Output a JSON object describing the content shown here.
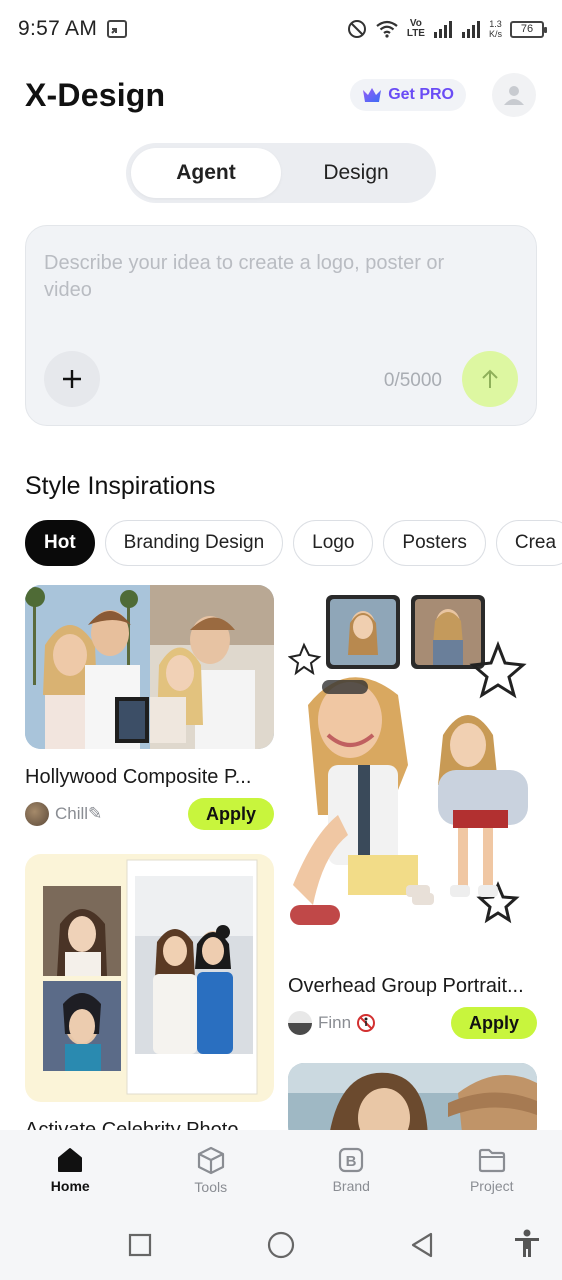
{
  "status_bar": {
    "time": "9:57 AM",
    "network_top": "Vo",
    "network_bottom": "LTE",
    "speed_top": "1.3",
    "speed_bottom": "K/s",
    "battery": "76"
  },
  "header": {
    "title": "X-Design",
    "get_pro_label": "Get PRO",
    "pro_color": "#6a4cf5"
  },
  "mode_switch": {
    "agent_label": "Agent",
    "design_label": "Design",
    "selected": "Agent"
  },
  "prompt": {
    "placeholder": "Describe your idea to create a logo, poster or video",
    "counter": "0/5000",
    "send_color": "#ddf7a1"
  },
  "inspirations": {
    "title": "Style Inspirations",
    "chips": [
      "Hot",
      "Branding Design",
      "Logo",
      "Posters",
      "Crea"
    ],
    "selected_chip": "Hot"
  },
  "cards": {
    "card1": {
      "title": "Hollywood Composite P...",
      "author": "Chill✎",
      "apply_label": "Apply"
    },
    "card2": {
      "title": "Overhead Group Portrait...",
      "author": "Finn",
      "apply_label": "Apply"
    },
    "card3": {
      "title": "Activate Celebrity Photo"
    },
    "apply_color": "#c8f53d"
  },
  "bottom_nav": {
    "items": [
      {
        "label": "Home",
        "icon": "home-icon"
      },
      {
        "label": "Tools",
        "icon": "cube-icon"
      },
      {
        "label": "Brand",
        "icon": "brand-b-icon"
      },
      {
        "label": "Project",
        "icon": "folder-icon"
      }
    ],
    "selected": "Home"
  },
  "system_nav": {
    "icons": [
      "recents-square-icon",
      "home-circle-icon",
      "back-triangle-icon",
      "accessibility-icon"
    ]
  }
}
